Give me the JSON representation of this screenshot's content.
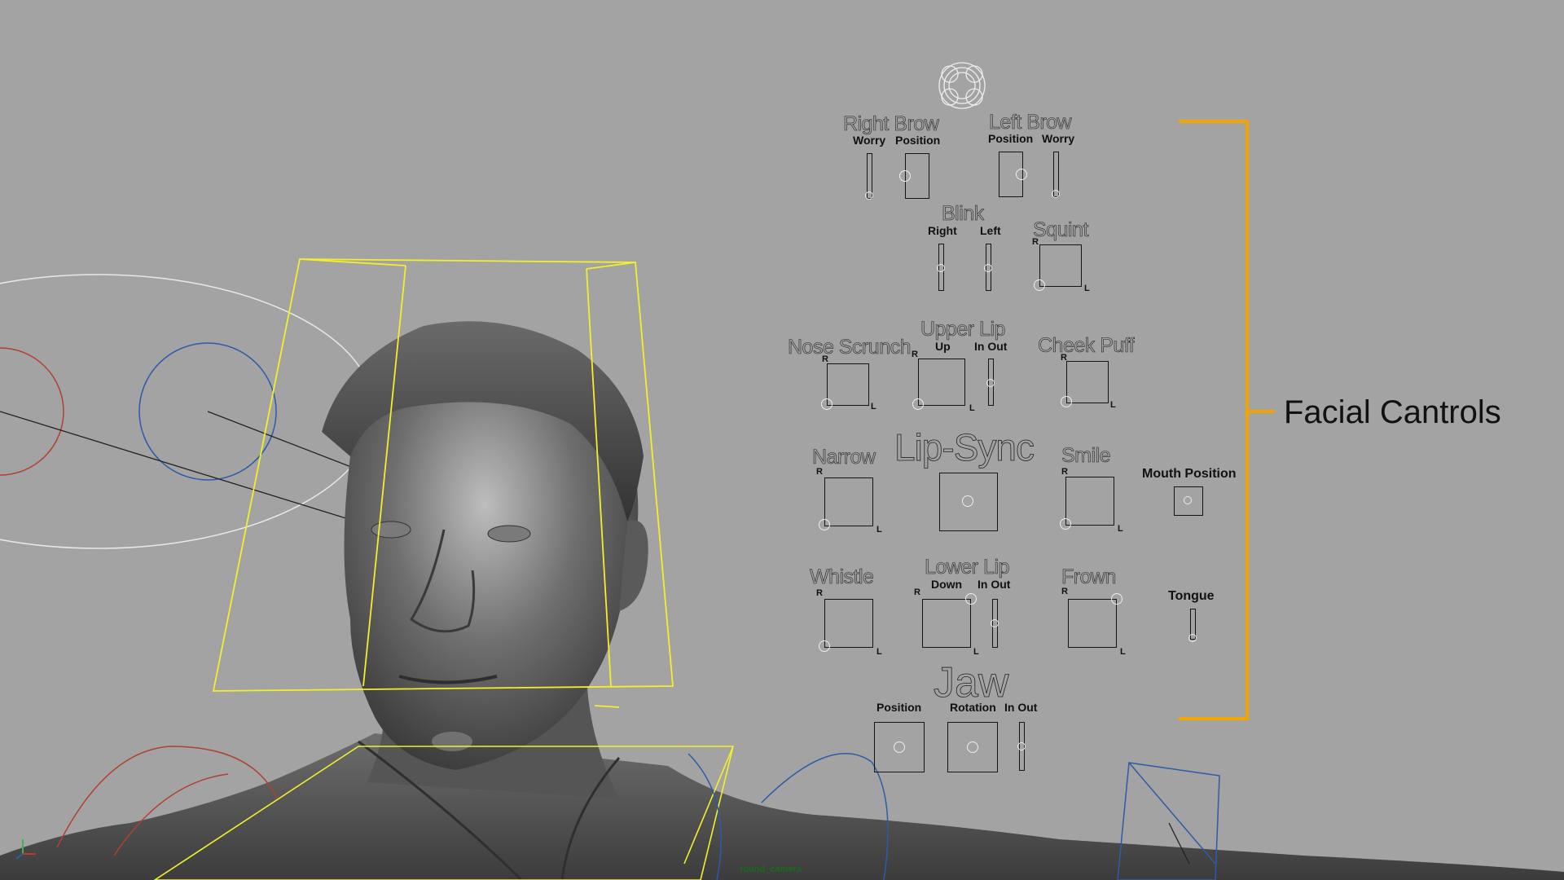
{
  "scene": {
    "camera_name": "round_camera",
    "bracket_color": "#f0a500",
    "wire_yellow": "#f3ef2a",
    "wire_blue": "#2b5ca8",
    "wire_red": "#b0412e",
    "background": "#a3a3a3"
  },
  "annotation": {
    "label": "Facial Cantrols"
  },
  "controls": {
    "right_brow": {
      "title": "Right Brow",
      "worry": "Worry",
      "position": "Position"
    },
    "left_brow": {
      "title": "Left Brow",
      "position": "Position",
      "worry": "Worry"
    },
    "blink": {
      "title": "Blink",
      "right": "Right",
      "left": "Left"
    },
    "squint": {
      "title": "Squint"
    },
    "nose_scrunch": {
      "title": "Nose Scrunch"
    },
    "upper_lip": {
      "title": "Upper Lip",
      "up": "Up",
      "in_out": "In Out"
    },
    "cheek_puff": {
      "title": "Cheek Puff"
    },
    "narrow": {
      "title": "Narrow"
    },
    "lip_sync": {
      "title": "Lip-Sync"
    },
    "smile": {
      "title": "Smile"
    },
    "mouth_position": {
      "title": "Mouth Position"
    },
    "whistle": {
      "title": "Whistle"
    },
    "lower_lip": {
      "title": "Lower Lip",
      "down": "Down",
      "in_out": "In Out"
    },
    "frown": {
      "title": "Frown"
    },
    "tongue": {
      "title": "Tongue"
    },
    "jaw": {
      "title": "Jaw",
      "position": "Position",
      "rotation": "Rotation",
      "in_out": "In Out"
    },
    "r_mark": "R",
    "l_mark": "L"
  }
}
